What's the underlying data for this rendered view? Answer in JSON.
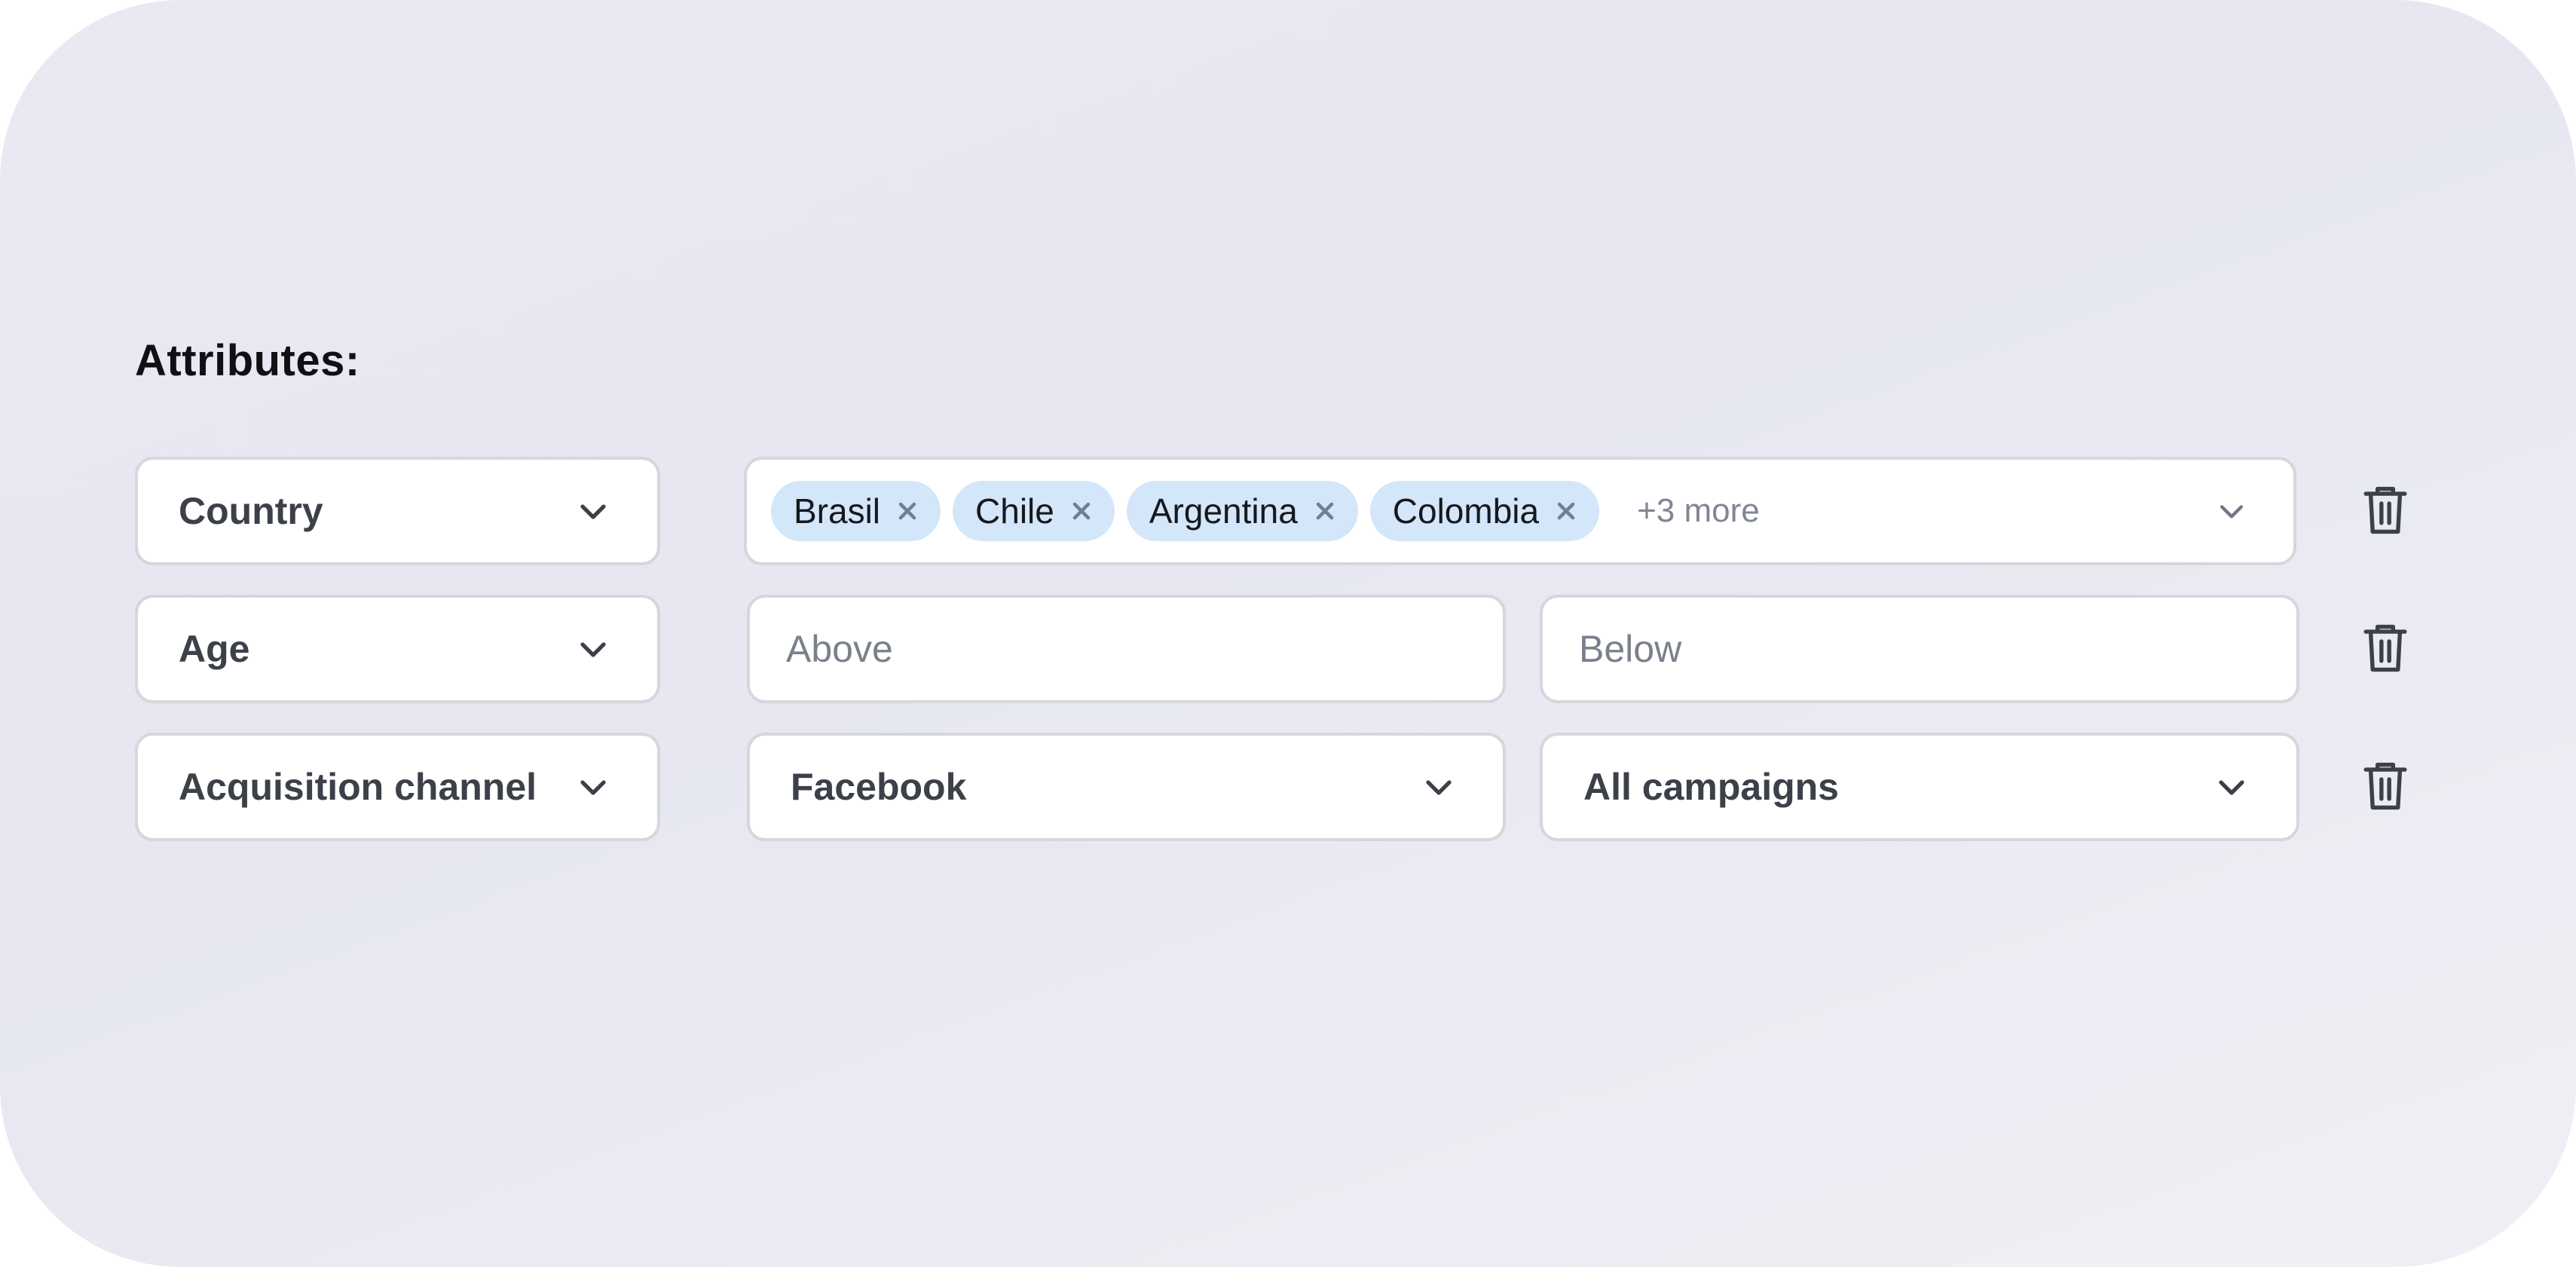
{
  "title": "Attributes:",
  "rows": [
    {
      "attribute": "Country",
      "chips": [
        "Brasil",
        "Chile",
        "Argentina",
        "Colombia"
      ],
      "more": "+3 more"
    },
    {
      "attribute": "Age",
      "above_placeholder": "Above",
      "below_placeholder": "Below"
    },
    {
      "attribute": "Acquisition channel",
      "channel": "Facebook",
      "campaign": "All campaigns"
    }
  ],
  "icons": {
    "dropdown": "chevron-down-icon",
    "remove_chip": "close-icon",
    "delete_row": "trash-icon"
  },
  "colors": {
    "chip_background": "#d3e6fa",
    "border": "#d7d6dd",
    "text_dark": "#3c4049",
    "placeholder": "#7a808c"
  }
}
